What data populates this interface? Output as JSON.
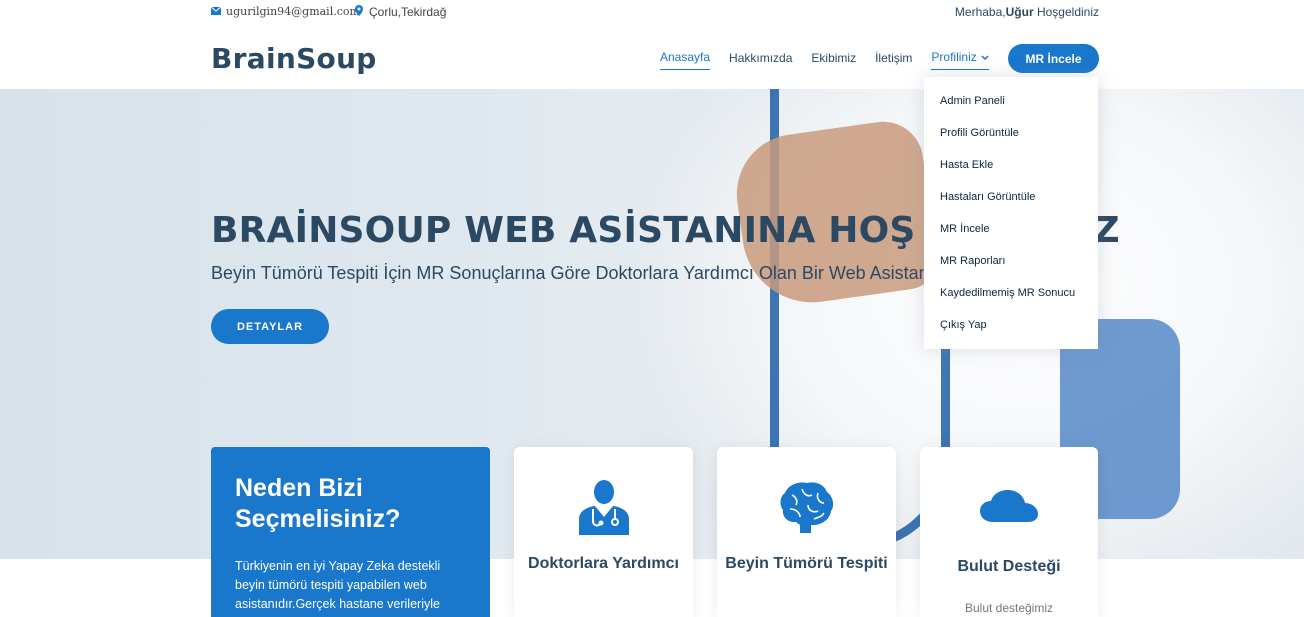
{
  "topbar": {
    "email": "ugurilgin94@gmail.com",
    "location": "Çorlu,Tekirdağ",
    "greeting_prefix": "Merhaba,",
    "greeting_name": "Uğur",
    "greeting_suffix": " Hoşgeldiniz"
  },
  "header": {
    "logo": "BrainSoup",
    "nav": [
      "Anasayfa",
      "Hakkımızda",
      "Ekibimiz",
      "İletişim",
      "Profiliniz"
    ],
    "cta": "MR İncele"
  },
  "dropdown": {
    "items": [
      "Admin Paneli",
      "Profili Görüntüle",
      "Hasta Ekle",
      "Hastaları Görüntüle",
      "MR İncele",
      "MR Raporları",
      "Kaydedilmemiş MR Sonucu",
      "Çıkış Yap"
    ]
  },
  "hero": {
    "title": "BRAİNSOUP WEB ASİSTANINA HOŞ GELDİNİZ",
    "subtitle": "Beyin Tümörü Tespiti İçin MR Sonuçlarına Göre Doktorlara Yardımcı Olan Bir Web Asistanı",
    "button": "DETAYLAR"
  },
  "why": {
    "title": "Neden Bizi Seçmelisiniz?",
    "text": "Türkiyenin en iyi Yapay Zeka destekli beyin tümörü tespiti yapabilen web asistanıdır.Gerçek hastane verileriyle"
  },
  "cards": [
    {
      "title": "Doktorlara Yardımcı",
      "icon": "doctor-icon"
    },
    {
      "title": "Beyin Tümörü Tespiti",
      "icon": "brain-icon"
    },
    {
      "title": "Bulut Desteği",
      "icon": "cloud-icon",
      "text": "Bulut desteğimiz"
    }
  ],
  "colors": {
    "accent": "#1977cc",
    "text": "#2c4964"
  }
}
